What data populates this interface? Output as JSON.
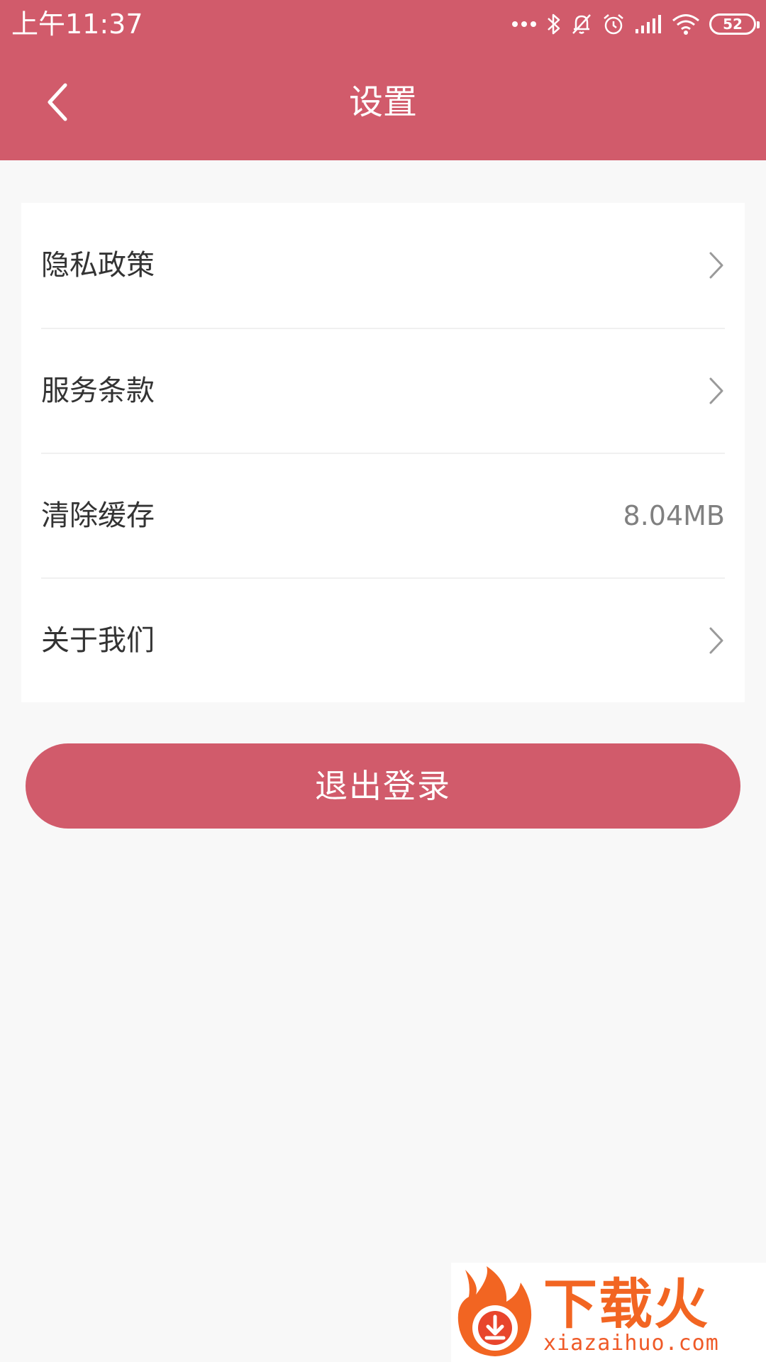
{
  "status_bar": {
    "time": "上午11:37",
    "battery_level": "52",
    "icons": [
      "more-dots-icon",
      "bluetooth-icon",
      "mute-bell-icon",
      "alarm-icon",
      "signal-icon",
      "wifi-icon",
      "battery-icon"
    ]
  },
  "header": {
    "title": "设置",
    "back_icon": "chevron-left-icon",
    "background_color": "#d15b6b",
    "text_color": "#ffffff"
  },
  "settings": {
    "items": [
      {
        "label": "隐私政策",
        "value": "",
        "trailing": "chevron-right-icon"
      },
      {
        "label": "服务条款",
        "value": "",
        "trailing": "chevron-right-icon"
      },
      {
        "label": "清除缓存",
        "value": "8.04MB",
        "trailing": ""
      },
      {
        "label": "关于我们",
        "value": "",
        "trailing": "chevron-right-icon"
      }
    ]
  },
  "logout": {
    "label": "退出登录",
    "color": "#d15b6b"
  },
  "watermark": {
    "title": "下载火",
    "url": "xiazaihuo.com",
    "color": "#f26522"
  },
  "colors": {
    "page_background": "#f8f8f8",
    "card_background": "#ffffff",
    "row_label": "#333333",
    "row_value": "#808080",
    "chevron": "#9a9a9a",
    "divider": "#f0f0f0"
  }
}
